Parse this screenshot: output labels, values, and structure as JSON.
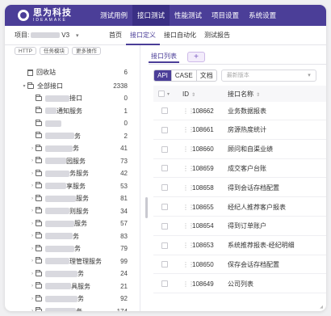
{
  "app": {
    "logo_cn": "思为科技",
    "logo_en": "IDEAMAKE",
    "brand_color": "#4b3e98"
  },
  "topnav": {
    "items": [
      {
        "label": "测试用例",
        "active": false
      },
      {
        "label": "接口测试",
        "active": true
      },
      {
        "label": "性能测试",
        "active": false
      },
      {
        "label": "项目设置",
        "active": false
      },
      {
        "label": "系统设置",
        "active": false
      }
    ]
  },
  "subbar": {
    "project_prefix": "项目:",
    "project_suffix": "V3",
    "tabs": [
      {
        "label": "首页",
        "active": false
      },
      {
        "label": "接口定义",
        "active": true
      },
      {
        "label": "接口自动化",
        "active": false
      },
      {
        "label": "测试报告",
        "active": false
      }
    ]
  },
  "left": {
    "filter_pills": [
      "HTTP",
      "任务模块",
      "更多操作"
    ],
    "recycle": {
      "label": "回收站",
      "count": "6"
    },
    "root": {
      "label": "全部接口",
      "count": "2338"
    },
    "folders": [
      {
        "visible_text": "接口",
        "count": "0"
      },
      {
        "visible_text": "通知服务",
        "count": "1"
      },
      {
        "visible_text": "",
        "count": "0"
      },
      {
        "visible_text": "务",
        "count": "2"
      },
      {
        "visible_text": "务",
        "count": "41"
      },
      {
        "visible_text": "园服务",
        "count": "73"
      },
      {
        "visible_text": "务服务",
        "count": "42"
      },
      {
        "visible_text": "享服务",
        "count": "53"
      },
      {
        "visible_text": "服务",
        "count": "81"
      },
      {
        "visible_text": "则服务",
        "count": "34"
      },
      {
        "visible_text": "服务",
        "count": "57"
      },
      {
        "visible_text": "务",
        "count": "83"
      },
      {
        "visible_text": "务",
        "count": "79"
      },
      {
        "visible_text": "理管理服务",
        "count": "99"
      },
      {
        "visible_text": "务",
        "count": "24"
      },
      {
        "visible_text": "具服务",
        "count": "21"
      },
      {
        "visible_text": "务",
        "count": "92"
      },
      {
        "visible_text": "务",
        "count": "174"
      },
      {
        "visible_text": "园服务",
        "count": "18"
      }
    ]
  },
  "right": {
    "tab_label": "接口列表",
    "plus_label": "+",
    "segments": [
      {
        "label": "API",
        "active": true
      },
      {
        "label": "CASE",
        "active": false
      },
      {
        "label": "文档",
        "active": false
      }
    ],
    "version_placeholder": "最新版本",
    "columns": {
      "id": "ID",
      "name": "接口名称"
    },
    "rows": [
      {
        "id": "108662",
        "name": "业务数据报表"
      },
      {
        "id": "108661",
        "name": "房源热度统计"
      },
      {
        "id": "108660",
        "name": "顾问和自渠业绩"
      },
      {
        "id": "108659",
        "name": "成交客户台账"
      },
      {
        "id": "108658",
        "name": "得到会话存档配置"
      },
      {
        "id": "108655",
        "name": "经纪人推荐客户报表"
      },
      {
        "id": "108654",
        "name": "得到订单账户"
      },
      {
        "id": "108653",
        "name": "系统推荐报表-经纪明细"
      },
      {
        "id": "108650",
        "name": "保存会话存档配置"
      },
      {
        "id": "108649",
        "name": "公司列表"
      }
    ]
  }
}
